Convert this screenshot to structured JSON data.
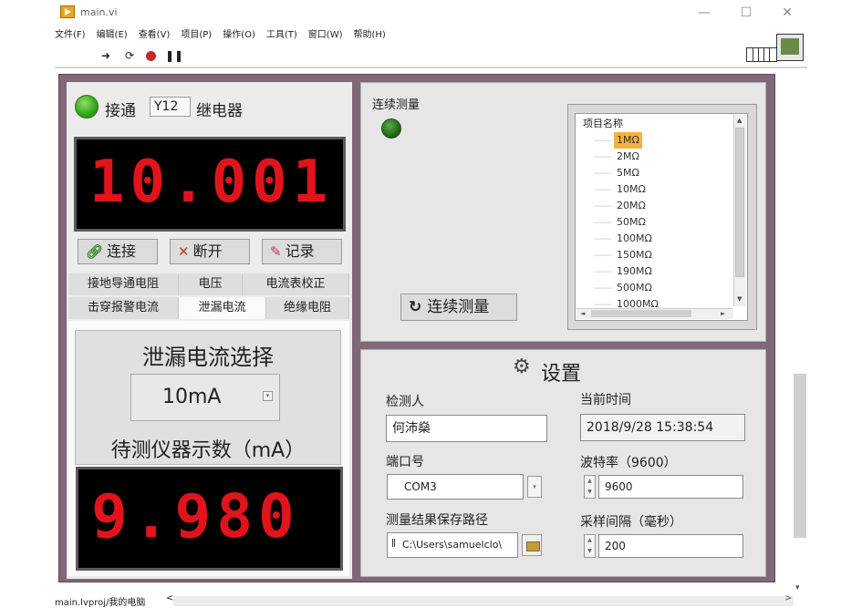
{
  "window": {
    "title": "main.vi",
    "min": "—",
    "max": "☐",
    "close": "✕"
  },
  "menu": [
    "文件(F)",
    "编辑(E)",
    "查看(V)",
    "项目(P)",
    "操作(O)",
    "工具(T)",
    "窗口(W)",
    "帮助(H)"
  ],
  "toolbar": {
    "run": "➜",
    "run_continuous": "⟳",
    "pause": "❚❚"
  },
  "relay": {
    "connect_label": "接通",
    "relay_id": "Y12",
    "relay_label": "继电器"
  },
  "display_main": "10.001",
  "buttons": {
    "connect": "连接",
    "disconnect": "断开",
    "record": "记录"
  },
  "tabs_row1": [
    "接地导通电阻",
    "电压",
    "电流表校正"
  ],
  "tabs_row2": [
    "击穿报警电流",
    "泄漏电流",
    "绝缘电阻"
  ],
  "leakage": {
    "title": "泄漏电流选择",
    "selected": "10mA",
    "reading_label": "待测仪器示数（mA）",
    "reading_value": "9.980"
  },
  "continuous": {
    "label": "连续测量",
    "button": "连续测量"
  },
  "listbox": {
    "header": "项目名称",
    "items": [
      "1MΩ",
      "2MΩ",
      "5MΩ",
      "10MΩ",
      "20MΩ",
      "50MΩ",
      "100MΩ",
      "150MΩ",
      "190MΩ",
      "500MΩ",
      "1000MΩ"
    ],
    "selected_index": 0
  },
  "settings": {
    "title": "设置",
    "inspector_label": "检测人",
    "inspector_value": "何沛燊",
    "time_label": "当前时间",
    "time_value": "2018/9/28 15:38:54",
    "port_label": "端口号",
    "port_value": "COM3",
    "baud_label": "波特率（9600）",
    "baud_value": "9600",
    "path_label": "测量结果保存路径",
    "path_value": "C:\\Users\\samuelclo\\",
    "interval_label": "采样间隔（毫秒）",
    "interval_value": "200"
  },
  "status": "main.lvproj/我的电脑"
}
